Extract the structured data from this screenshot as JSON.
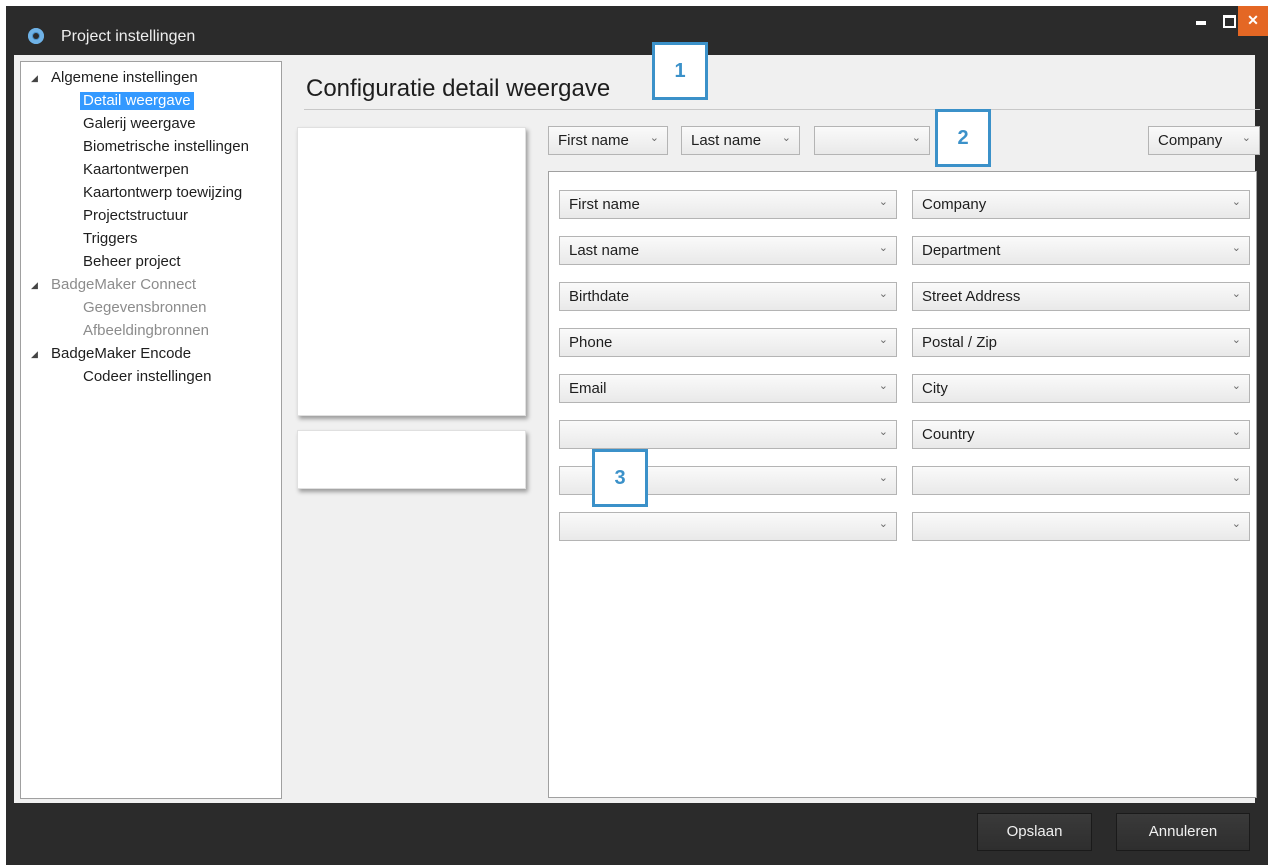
{
  "window": {
    "title": "Project instellingen",
    "accent": "#3b91c9",
    "close_color": "#e46724"
  },
  "tree": [
    {
      "label": "Algemene instellingen",
      "level": 0,
      "expanded": true,
      "state": "normal"
    },
    {
      "label": "Detail weergave",
      "level": 1,
      "state": "selected"
    },
    {
      "label": "Galerij weergave",
      "level": 1,
      "state": "normal"
    },
    {
      "label": "Biometrische instellingen",
      "level": 1,
      "state": "normal"
    },
    {
      "label": "Kaartontwerpen",
      "level": 1,
      "state": "normal"
    },
    {
      "label": "Kaartontwerp toewijzing",
      "level": 1,
      "state": "normal"
    },
    {
      "label": "Projectstructuur",
      "level": 1,
      "state": "normal"
    },
    {
      "label": "Triggers",
      "level": 1,
      "state": "normal"
    },
    {
      "label": "Beheer project",
      "level": 1,
      "state": "normal"
    },
    {
      "label": "BadgeMaker Connect",
      "level": 0,
      "expanded": true,
      "state": "disabled"
    },
    {
      "label": "Gegevensbronnen",
      "level": 1,
      "state": "disabled"
    },
    {
      "label": "Afbeeldingbronnen",
      "level": 1,
      "state": "disabled"
    },
    {
      "label": "BadgeMaker Encode",
      "level": 0,
      "expanded": true,
      "state": "normal"
    },
    {
      "label": "Codeer instellingen",
      "level": 1,
      "state": "normal"
    }
  ],
  "page": {
    "title": "Configuratie detail weergave"
  },
  "header_fields": {
    "first": "First name",
    "second": "Last name",
    "third": "",
    "right": "Company"
  },
  "detail_fields": {
    "left": [
      "First name",
      "Last name",
      "Birthdate",
      "Phone",
      "Email",
      "",
      "",
      ""
    ],
    "right": [
      "Company",
      "Department",
      "Street Address",
      "Postal / Zip",
      "City",
      "Country",
      "",
      ""
    ]
  },
  "callouts": [
    "1",
    "2",
    "3"
  ],
  "footer": {
    "save_label": "Opslaan",
    "cancel_label": "Annuleren"
  }
}
